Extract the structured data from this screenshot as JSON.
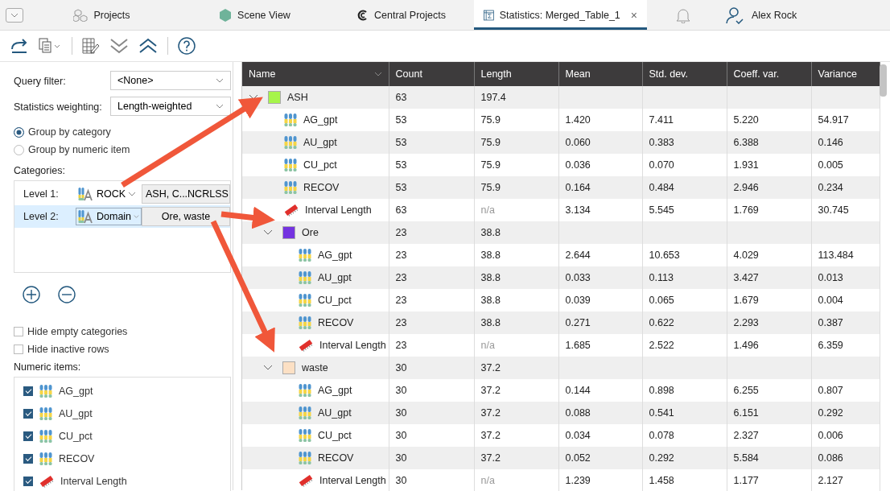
{
  "tabs": [
    {
      "label": "Projects",
      "kind": "projects",
      "selected": false
    },
    {
      "label": "Scene View",
      "kind": "scene",
      "selected": false
    },
    {
      "label": "Central Projects",
      "kind": "central",
      "selected": false
    },
    {
      "label": "Statistics: Merged_Table_1",
      "kind": "stats",
      "selected": true,
      "close": "×"
    }
  ],
  "user": {
    "name": "Alex Rock"
  },
  "settings": {
    "query_filter": {
      "label": "Query filter:",
      "value": "<None>"
    },
    "weighting": {
      "label": "Statistics weighting:",
      "value": "Length-weighted"
    },
    "grouping": [
      {
        "label": "Group by category",
        "selected": true
      },
      {
        "label": "Group by numeric item",
        "selected": false
      }
    ],
    "categories_label": "Categories:",
    "levels": [
      {
        "label": "Level 1:",
        "column": "ROCK",
        "values": "ASH, C...NCRLSS",
        "selected": false
      },
      {
        "label": "Level 2:",
        "column": "Domain",
        "values": "Ore, waste",
        "selected": true
      }
    ],
    "options": [
      {
        "label": "Hide empty categories",
        "checked": false
      },
      {
        "label": "Hide inactive rows",
        "checked": false
      }
    ],
    "numeric_label": "Numeric items:",
    "numeric_items": [
      {
        "label": "AG_gpt",
        "kind": "numeric",
        "checked": true
      },
      {
        "label": "AU_gpt",
        "kind": "numeric",
        "checked": true
      },
      {
        "label": "CU_pct",
        "kind": "numeric",
        "checked": true
      },
      {
        "label": "RECOV",
        "kind": "numeric",
        "checked": true
      },
      {
        "label": "Interval Length",
        "kind": "interval",
        "checked": true
      }
    ]
  },
  "table": {
    "columns": [
      "Name",
      "Count",
      "Length",
      "Mean",
      "Std. dev.",
      "Coeff. var.",
      "Variance"
    ],
    "rows": [
      {
        "kind": "category",
        "color": "#a6f54a",
        "expanded": true,
        "cells": [
          "ASH",
          "63",
          "197.4",
          "",
          "",
          "",
          ""
        ],
        "children": [
          {
            "kind": "numeric",
            "cells": [
              "AG_gpt",
              "53",
              "75.9",
              "1.420",
              "7.411",
              "5.220",
              "54.917"
            ]
          },
          {
            "kind": "numeric",
            "cells": [
              "AU_gpt",
              "53",
              "75.9",
              "0.060",
              "0.383",
              "6.388",
              "0.146"
            ]
          },
          {
            "kind": "numeric",
            "cells": [
              "CU_pct",
              "53",
              "75.9",
              "0.036",
              "0.070",
              "1.931",
              "0.005"
            ]
          },
          {
            "kind": "numeric",
            "cells": [
              "RECOV",
              "53",
              "75.9",
              "0.164",
              "0.484",
              "2.946",
              "0.234"
            ]
          },
          {
            "kind": "interval",
            "cells": [
              "Interval Length",
              "63",
              "n/a",
              "3.134",
              "5.545",
              "1.769",
              "30.745"
            ]
          },
          {
            "kind": "category",
            "color": "#7433e0",
            "expanded": true,
            "cells": [
              "Ore",
              "23",
              "38.8",
              "",
              "",
              "",
              ""
            ],
            "children": [
              {
                "kind": "numeric",
                "cells": [
                  "AG_gpt",
                  "23",
                  "38.8",
                  "2.644",
                  "10.653",
                  "4.029",
                  "113.484"
                ]
              },
              {
                "kind": "numeric",
                "cells": [
                  "AU_gpt",
                  "23",
                  "38.8",
                  "0.033",
                  "0.113",
                  "3.427",
                  "0.013"
                ]
              },
              {
                "kind": "numeric",
                "cells": [
                  "CU_pct",
                  "23",
                  "38.8",
                  "0.039",
                  "0.065",
                  "1.679",
                  "0.004"
                ]
              },
              {
                "kind": "numeric",
                "cells": [
                  "RECOV",
                  "23",
                  "38.8",
                  "0.271",
                  "0.622",
                  "2.293",
                  "0.387"
                ]
              },
              {
                "kind": "interval",
                "cells": [
                  "Interval Length",
                  "23",
                  "n/a",
                  "1.685",
                  "2.522",
                  "1.496",
                  "6.359"
                ]
              }
            ]
          },
          {
            "kind": "category",
            "color": "#fce0c4",
            "expanded": true,
            "cells": [
              "waste",
              "30",
              "37.2",
              "",
              "",
              "",
              ""
            ],
            "children": [
              {
                "kind": "numeric",
                "cells": [
                  "AG_gpt",
                  "30",
                  "37.2",
                  "0.144",
                  "0.898",
                  "6.255",
                  "0.807"
                ]
              },
              {
                "kind": "numeric",
                "cells": [
                  "AU_gpt",
                  "30",
                  "37.2",
                  "0.088",
                  "0.541",
                  "6.151",
                  "0.292"
                ]
              },
              {
                "kind": "numeric",
                "cells": [
                  "CU_pct",
                  "30",
                  "37.2",
                  "0.034",
                  "0.078",
                  "2.327",
                  "0.006"
                ]
              },
              {
                "kind": "numeric",
                "cells": [
                  "RECOV",
                  "30",
                  "37.2",
                  "0.052",
                  "0.292",
                  "5.584",
                  "0.086"
                ]
              },
              {
                "kind": "interval",
                "cells": [
                  "Interval Length",
                  "30",
                  "n/a",
                  "1.239",
                  "1.458",
                  "1.177",
                  "2.127"
                ]
              }
            ]
          }
        ]
      }
    ]
  }
}
